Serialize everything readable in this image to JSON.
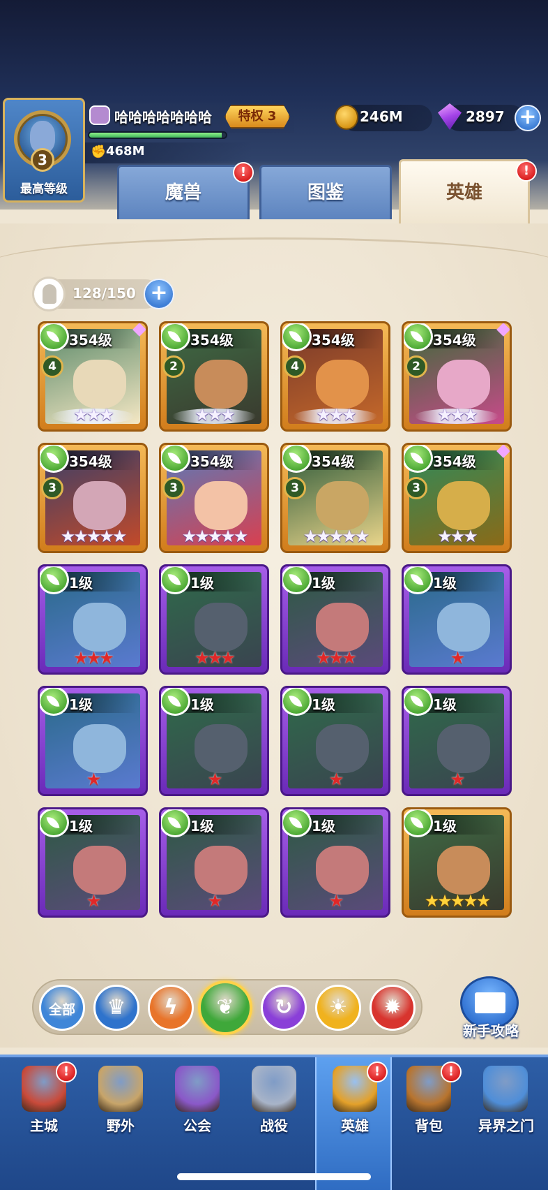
{
  "header": {
    "avatar_level": "3",
    "avatar_label": "最高等级",
    "player_name": "哈哈哈哈哈哈哈",
    "vip_label": "特权 3",
    "xp_progress": 0.97,
    "power_value": "468M",
    "gold_value": "246M",
    "gem_value": "2897",
    "plus_symbol": "+"
  },
  "tabs": [
    {
      "label": "魔兽",
      "badge": "!",
      "active": false
    },
    {
      "label": "图鉴",
      "badge": "",
      "active": false
    },
    {
      "label": "英雄",
      "badge": "!",
      "active": true
    }
  ],
  "capacity": {
    "text": "128/150",
    "plus": "+"
  },
  "heroes": [
    {
      "level": "354级",
      "rank": "4",
      "frame": "gold",
      "stars": "★★★",
      "star_color": "white",
      "wings": true,
      "art": "elf-queen"
    },
    {
      "level": "354级",
      "rank": "2",
      "frame": "gold",
      "stars": "★★★",
      "star_color": "white",
      "wings": true,
      "art": "warrior"
    },
    {
      "level": "354级",
      "rank": "4",
      "frame": "gold",
      "stars": "★★★",
      "star_color": "white",
      "wings": true,
      "art": "dragon"
    },
    {
      "level": "354级",
      "rank": "2",
      "frame": "gold",
      "stars": "★★★",
      "star_color": "white",
      "wings": true,
      "art": "fairy"
    },
    {
      "level": "354级",
      "rank": "3",
      "frame": "gold",
      "stars": "★★★★★",
      "star_color": "white",
      "wings": false,
      "art": "dark-elf"
    },
    {
      "level": "354级",
      "rank": "3",
      "frame": "gold",
      "stars": "★★★★★",
      "star_color": "white",
      "wings": false,
      "art": "red-hair"
    },
    {
      "level": "354级",
      "rank": "3",
      "frame": "gold",
      "stars": "★★★★★",
      "star_color": "white",
      "wings": false,
      "art": "dwarf"
    },
    {
      "level": "354级",
      "rank": "3",
      "frame": "gold",
      "stars": "★★★",
      "star_color": "white",
      "wings": false,
      "art": "golden-knight"
    },
    {
      "level": "1级",
      "rank": "",
      "frame": "purple",
      "stars": "★★★",
      "star_color": "red",
      "wings": false,
      "art": "ice-elf"
    },
    {
      "level": "1级",
      "rank": "",
      "frame": "purple",
      "stars": "★★★",
      "star_color": "red",
      "wings": false,
      "art": "stone-golem"
    },
    {
      "level": "1级",
      "rank": "",
      "frame": "purple",
      "stars": "★★★",
      "star_color": "red",
      "wings": false,
      "art": "ranger"
    },
    {
      "level": "1级",
      "rank": "",
      "frame": "purple",
      "stars": "★",
      "star_color": "red",
      "wings": false,
      "art": "ice-elf"
    },
    {
      "level": "1级",
      "rank": "",
      "frame": "purple",
      "stars": "★",
      "star_color": "red",
      "wings": false,
      "art": "ice-elf"
    },
    {
      "level": "1级",
      "rank": "",
      "frame": "purple",
      "stars": "★",
      "star_color": "red",
      "wings": false,
      "art": "stone-golem"
    },
    {
      "level": "1级",
      "rank": "",
      "frame": "purple",
      "stars": "★",
      "star_color": "red",
      "wings": false,
      "art": "stone-golem"
    },
    {
      "level": "1级",
      "rank": "",
      "frame": "purple",
      "stars": "★",
      "star_color": "red",
      "wings": false,
      "art": "stone-golem"
    },
    {
      "level": "1级",
      "rank": "",
      "frame": "purple",
      "stars": "★",
      "star_color": "red",
      "wings": false,
      "art": "ranger"
    },
    {
      "level": "1级",
      "rank": "",
      "frame": "purple",
      "stars": "★",
      "star_color": "red",
      "wings": false,
      "art": "ranger"
    },
    {
      "level": "1级",
      "rank": "",
      "frame": "purple",
      "stars": "★",
      "star_color": "red",
      "wings": false,
      "art": "ranger"
    },
    {
      "level": "1级",
      "rank": "",
      "frame": "gold",
      "stars": "★★★★★",
      "star_color": "yellow",
      "wings": false,
      "art": "warrior"
    }
  ],
  "filters": [
    {
      "name": "all",
      "label": "全部",
      "color": "#3f86d8",
      "icon": "",
      "active": false
    },
    {
      "name": "crown",
      "label": "",
      "color": "#2f73cc",
      "icon": "♛",
      "active": false
    },
    {
      "name": "beast",
      "label": "",
      "color": "#e8742a",
      "icon": "ϟ",
      "active": false
    },
    {
      "name": "nature",
      "label": "",
      "color": "#3fa83a",
      "icon": "❦",
      "active": true
    },
    {
      "name": "arcane",
      "label": "",
      "color": "#8a3fd8",
      "icon": "↻",
      "active": false
    },
    {
      "name": "light",
      "label": "",
      "color": "#f0b21e",
      "icon": "☀",
      "active": false
    },
    {
      "name": "fire",
      "label": "",
      "color": "#d8342e",
      "icon": "✹",
      "active": false
    }
  ],
  "guide": {
    "label": "新手攻略"
  },
  "nav": [
    {
      "label": "主城",
      "icon": "castle-icon",
      "badge": "!",
      "active": false,
      "color": "#c94a3a"
    },
    {
      "label": "野外",
      "icon": "sword-stone-icon",
      "badge": "",
      "active": false,
      "color": "#c8a56a"
    },
    {
      "label": "公会",
      "icon": "guild-tower-icon",
      "badge": "",
      "active": false,
      "color": "#8a58c8"
    },
    {
      "label": "战役",
      "icon": "crossed-swords-icon",
      "badge": "",
      "active": false,
      "color": "#a8b4c8"
    },
    {
      "label": "英雄",
      "icon": "knight-helmet-icon",
      "badge": "!",
      "active": true,
      "color": "#e4a12a"
    },
    {
      "label": "背包",
      "icon": "backpack-icon",
      "badge": "!",
      "active": false,
      "color": "#b8742e"
    },
    {
      "label": "异界之门",
      "icon": "portal-icon",
      "badge": "",
      "active": false,
      "color": "#4f8ed8"
    }
  ],
  "colors": {
    "gold_frame": "#d17d1c",
    "purple_frame": "#6a2ab8",
    "tab_blue": "#5d84bf",
    "panel_bg": "#efe6d4",
    "nav_blue": "#2d5ea6"
  }
}
